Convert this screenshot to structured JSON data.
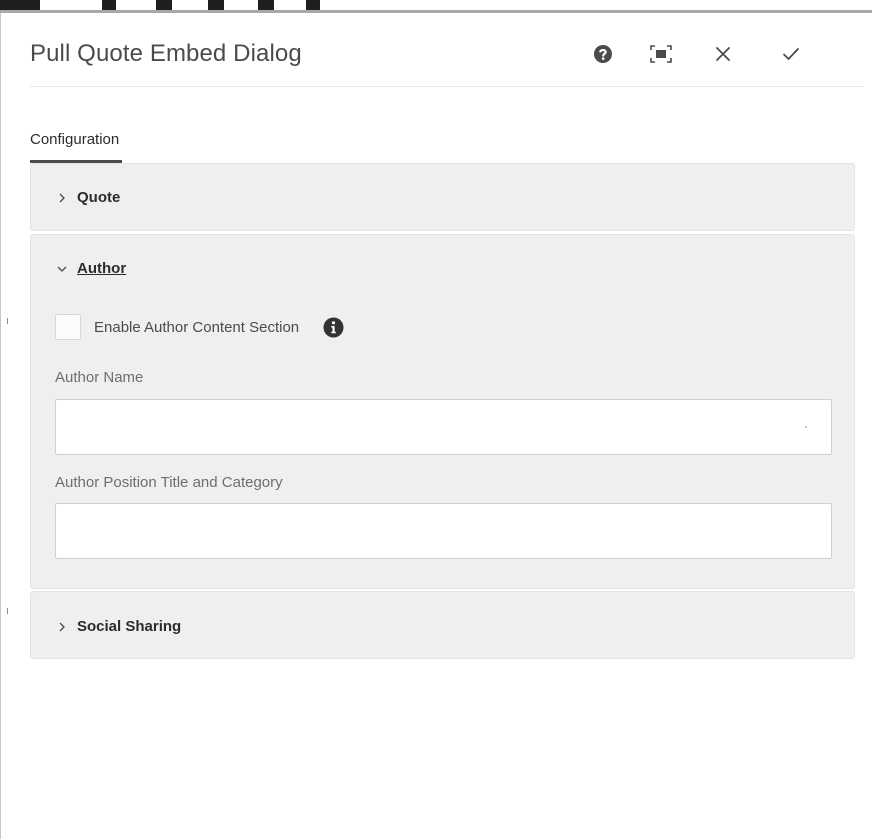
{
  "dialog": {
    "title": "Pull Quote Embed Dialog",
    "actions": [
      "help-icon",
      "fullscreen-icon",
      "close-icon",
      "checkmark-icon"
    ]
  },
  "tabs": [
    {
      "label": "Configuration",
      "active": true
    }
  ],
  "sections": {
    "quote": {
      "label": "Quote",
      "expanded": false
    },
    "author": {
      "label": "Author",
      "expanded": true,
      "enable_checkbox": {
        "label": "Enable Author Content Section",
        "checked": false
      },
      "author_name": {
        "label": "Author Name",
        "value": ""
      },
      "author_position": {
        "label": "Author Position Title and Category",
        "value": ""
      }
    },
    "social": {
      "label": "Social Sharing",
      "expanded": false
    }
  },
  "colors": {
    "text": "#4b4b4b",
    "panel_bg": "#efefef",
    "border": "#cfcfcf",
    "tab_underline": "#4b4b4b"
  }
}
